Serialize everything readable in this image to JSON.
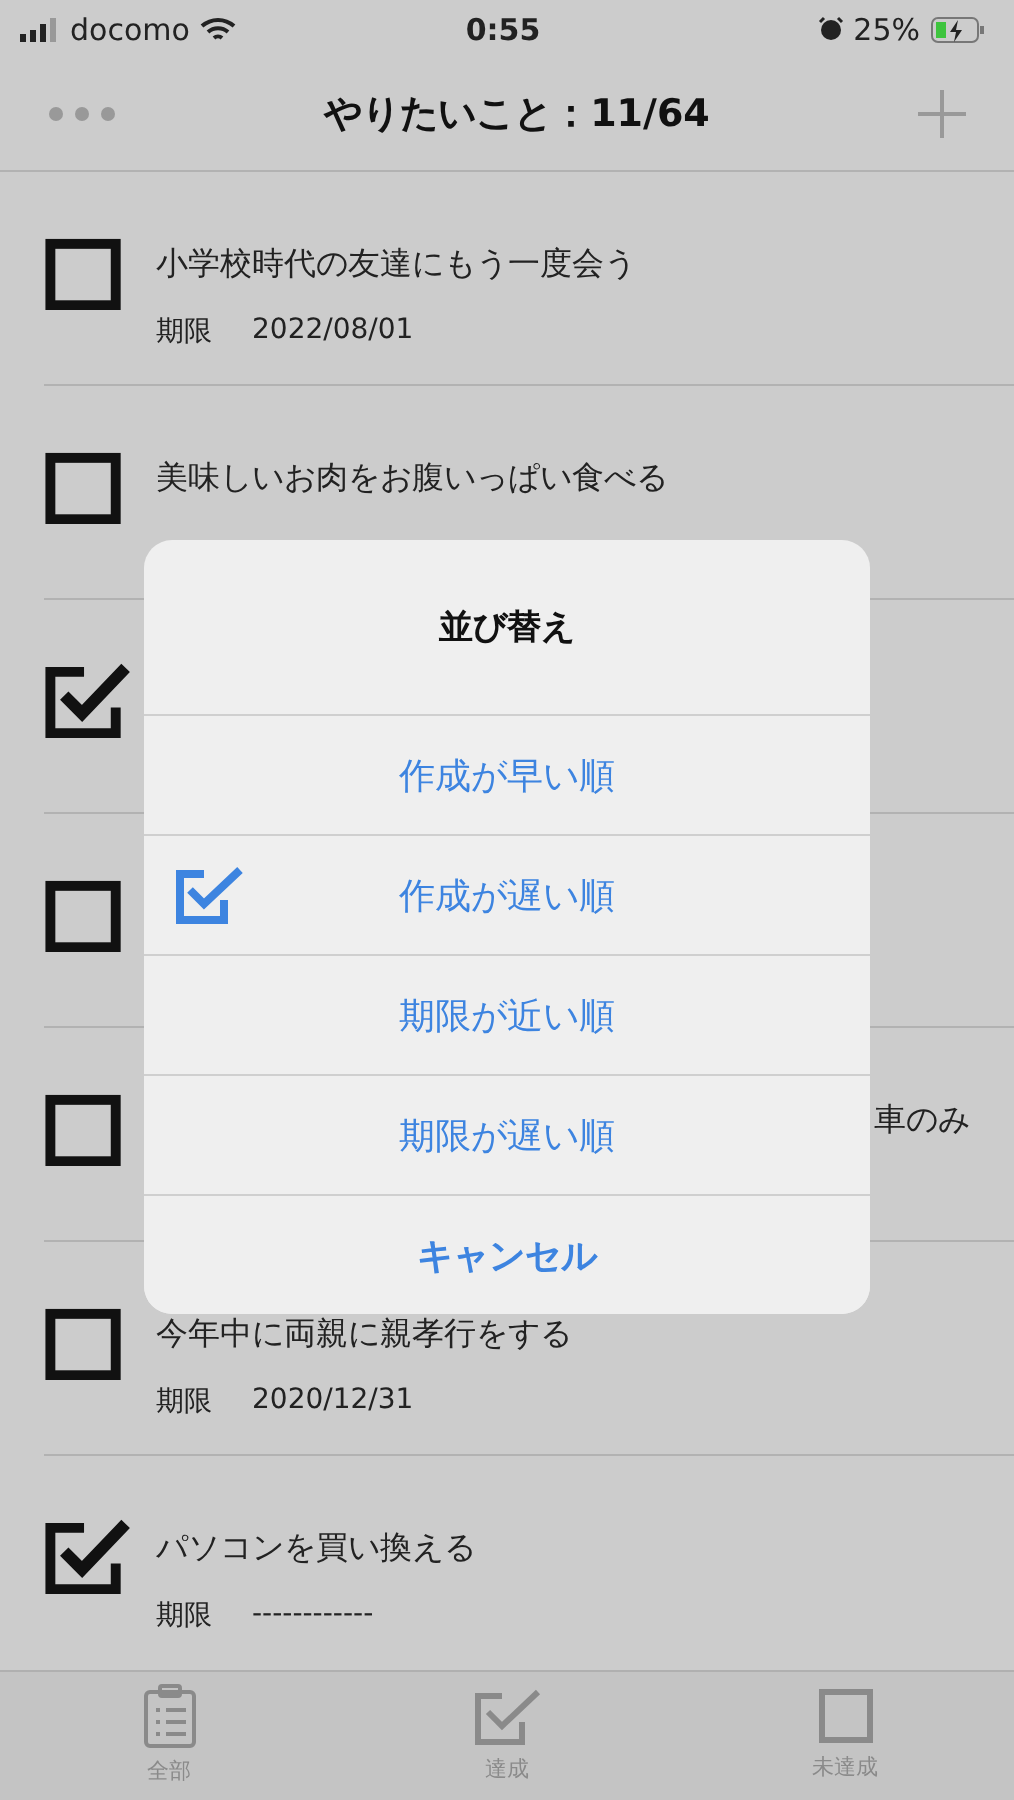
{
  "status_bar": {
    "carrier": "docomo",
    "time": "0:55",
    "battery": "25%"
  },
  "nav": {
    "title": "やりたいこと：11/64"
  },
  "rows": [
    {
      "title": "小学校時代の友達にもう一度会う",
      "deadline_label": "期限",
      "deadline": "2022/08/01",
      "checked": false
    },
    {
      "title": "美味しいお肉をお腹いっぱい食べる",
      "checked": false
    },
    {
      "checked": true
    },
    {
      "checked": false
    },
    {
      "title": "車のみ",
      "checked": false
    },
    {
      "title": "今年中に両親に親孝行をする",
      "deadline_label": "期限",
      "deadline": "2020/12/31",
      "checked": false
    },
    {
      "title": "パソコンを買い換える",
      "deadline_label": "期限",
      "deadline": "------------",
      "checked": true
    }
  ],
  "sort_dialog": {
    "title": "並び替え",
    "options": [
      {
        "label": "作成が早い順",
        "selected": false
      },
      {
        "label": "作成が遅い順",
        "selected": true
      },
      {
        "label": "期限が近い順",
        "selected": false
      },
      {
        "label": "期限が遅い順",
        "selected": false
      }
    ],
    "cancel": "キャンセル"
  },
  "tab_bar": [
    {
      "label": "全部",
      "kind": "all"
    },
    {
      "label": "達成",
      "kind": "done"
    },
    {
      "label": "未達成",
      "kind": "undone"
    }
  ]
}
